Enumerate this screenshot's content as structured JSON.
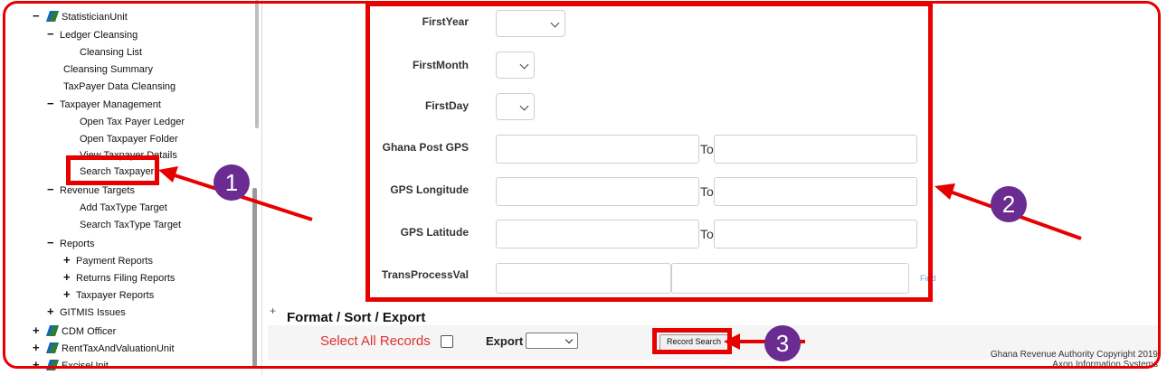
{
  "sidebar": {
    "items": [
      {
        "label": "StatisticianUnit",
        "toggle": "−",
        "folder": true
      },
      {
        "label": "Ledger Cleansing",
        "toggle": "−"
      },
      {
        "label": "Cleansing List"
      },
      {
        "label": "Cleansing Summary"
      },
      {
        "label": "TaxPayer Data Cleansing"
      },
      {
        "label": "Taxpayer Management",
        "toggle": "−"
      },
      {
        "label": "Open Tax Payer Ledger"
      },
      {
        "label": "Open Taxpayer Folder"
      },
      {
        "label": "View Taxpayer Details"
      },
      {
        "label": "Search Taxpayer"
      },
      {
        "label": "Revenue Targets",
        "toggle": "−"
      },
      {
        "label": "Add TaxType Target"
      },
      {
        "label": "Search TaxType Target"
      },
      {
        "label": "Reports",
        "toggle": "−"
      },
      {
        "label": "Payment Reports",
        "toggle": "+"
      },
      {
        "label": "Returns Filing Reports",
        "toggle": "+"
      },
      {
        "label": "Taxpayer Reports",
        "toggle": "+"
      },
      {
        "label": "GITMIS Issues",
        "toggle": "+"
      },
      {
        "label": "CDM Officer",
        "toggle": "+",
        "folder": true
      },
      {
        "label": "RentTaxAndValuationUnit",
        "toggle": "+",
        "folder": true
      },
      {
        "label": "ExciseUnit",
        "toggle": "+",
        "folder": true
      }
    ]
  },
  "form": {
    "first_year": "FirstYear",
    "first_month": "FirstMonth",
    "first_day": "FirstDay",
    "ghana_post_gps": "Ghana Post GPS",
    "gps_longitude": "GPS Longitude",
    "gps_latitude": "GPS Latitude",
    "trans_process_val": "TransProcessVal",
    "to": "To",
    "find": "Find"
  },
  "export": {
    "section_title": "Format / Sort / Export",
    "expand_icon": "+",
    "select_all": "Select All Records",
    "export_label": "Export",
    "record_search": "Record Search"
  },
  "footer": {
    "copyright": "Ghana Revenue Authority Copyright 2019",
    "vendor": "Axon Information Systems"
  },
  "annotations": {
    "badge_1": "1",
    "badge_2": "2",
    "badge_3": "3"
  },
  "colors": {
    "highlight": "#e60000",
    "badge": "#6a2c91",
    "select_all_text": "#e03030"
  }
}
